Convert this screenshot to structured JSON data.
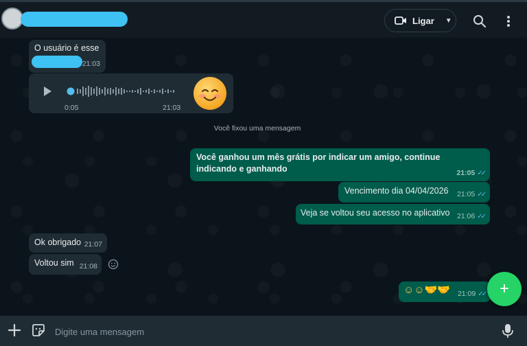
{
  "header": {
    "call_label": "Ligar"
  },
  "messages": {
    "m1_text": "O usuário é esse",
    "m1_time": "21:03",
    "voice_elapsed": "0:05",
    "voice_time": "21:03",
    "system_note": "Você fixou uma mensagem",
    "m3_text": "Você ganhou um mês grátis por indicar um amigo, continue indicando e ganhando",
    "m3_time": "21:05",
    "m4_text": "Vencimento dia 04/04/2026",
    "m4_time": "21:05",
    "m5_text": "Veja se voltou seu acesso no aplicativo",
    "m5_time": "21:06",
    "m6_text": "Ok obrigado",
    "m6_time": "21:07",
    "m7_text": "Voltou sim",
    "m7_time": "21:08",
    "m8_emojis": "☺☺🤝🤝",
    "m8_time": "21:09"
  },
  "composer": {
    "placeholder": "Digite uma mensagem"
  },
  "colors": {
    "accent": "#25d366",
    "outgoing_bubble": "#005c4b",
    "incoming_bubble": "#202c33",
    "read_ticks": "#53bdeb",
    "redaction": "#3ec1f3"
  },
  "icons": [
    "video-icon",
    "search-icon",
    "menu-dots-icon",
    "play-icon",
    "plus-icon",
    "sticker-icon",
    "mic-icon"
  ]
}
